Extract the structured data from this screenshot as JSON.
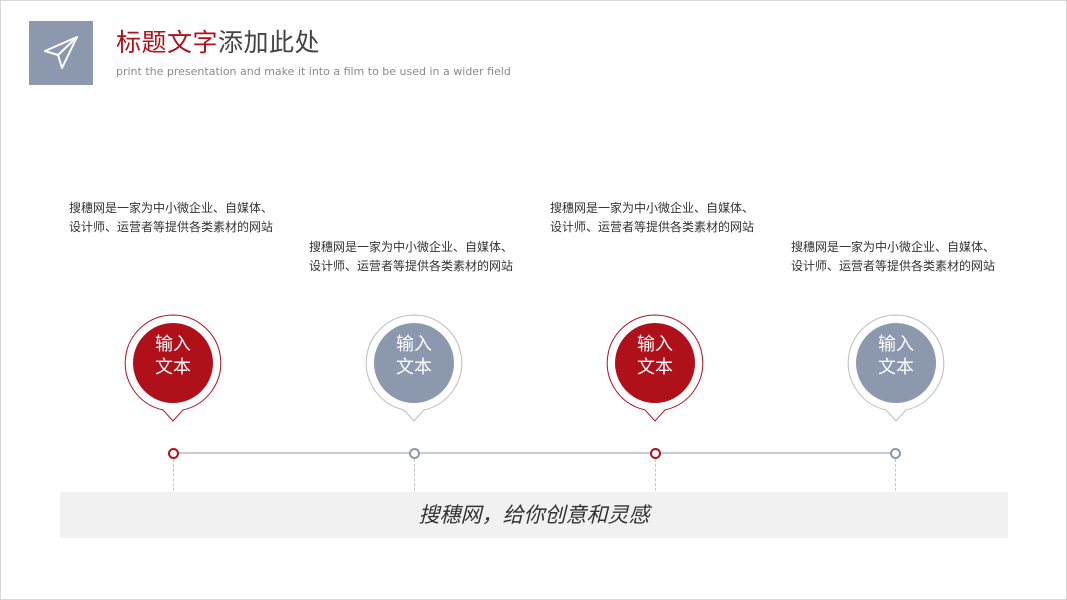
{
  "header": {
    "title_accent": "标题文字",
    "title_rest": "添加此处",
    "subtitle": "print the presentation and make it into a film to be used in a wider field",
    "logo_icon": "paper-plane-icon"
  },
  "colors": {
    "red": "#b0101a",
    "gray": "#8c98ad"
  },
  "steps": [
    {
      "line1": "输入",
      "line2": "文本",
      "color": "red",
      "desc_line1": "搜穗网是一家为中小微企业、自媒体、",
      "desc_line2": "设计师、运营者等提供各类素材的网站"
    },
    {
      "line1": "输入",
      "line2": "文本",
      "color": "gray",
      "desc_line1": "搜穗网是一家为中小微企业、自媒体、",
      "desc_line2": "设计师、运营者等提供各类素材的网站"
    },
    {
      "line1": "输入",
      "line2": "文本",
      "color": "red",
      "desc_line1": "搜穗网是一家为中小微企业、自媒体、",
      "desc_line2": "设计师、运营者等提供各类素材的网站"
    },
    {
      "line1": "输入",
      "line2": "文本",
      "color": "gray",
      "desc_line1": "搜穗网是一家为中小微企业、自媒体、",
      "desc_line2": "设计师、运营者等提供各类素材的网站"
    }
  ],
  "banner": {
    "text": "搜穗网，给你创意和灵感"
  }
}
